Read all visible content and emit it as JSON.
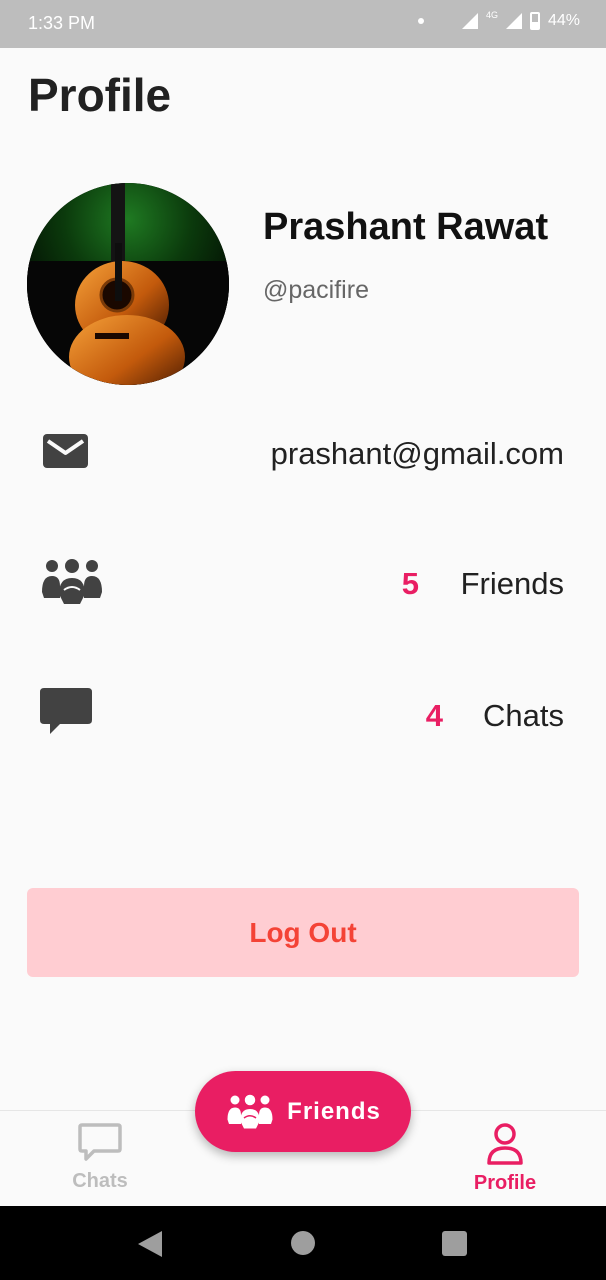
{
  "status_bar": {
    "time": "1:33 PM",
    "network": "4G",
    "battery": "44%"
  },
  "page": {
    "title": "Profile"
  },
  "profile": {
    "name": "Prashant Rawat",
    "handle": "@pacifire",
    "avatar_icon": "guitar-photo"
  },
  "info": {
    "email": "prashant@gmail.com",
    "friends_count": "5",
    "friends_label": "Friends",
    "chats_count": "4",
    "chats_label": "Chats"
  },
  "logout": {
    "label": "Log Out"
  },
  "fab": {
    "label": "Friends"
  },
  "bottom_nav": {
    "items": [
      {
        "label": "Chats",
        "icon": "chat-bubble-icon",
        "active": false
      },
      {
        "label": "Profile",
        "icon": "person-icon",
        "active": true
      }
    ]
  },
  "colors": {
    "accent": "#e91e63",
    "logout_bg": "#ffcdd2",
    "logout_text": "#f44336",
    "icon_dark": "#424242",
    "inactive": "#bdbdbd"
  }
}
